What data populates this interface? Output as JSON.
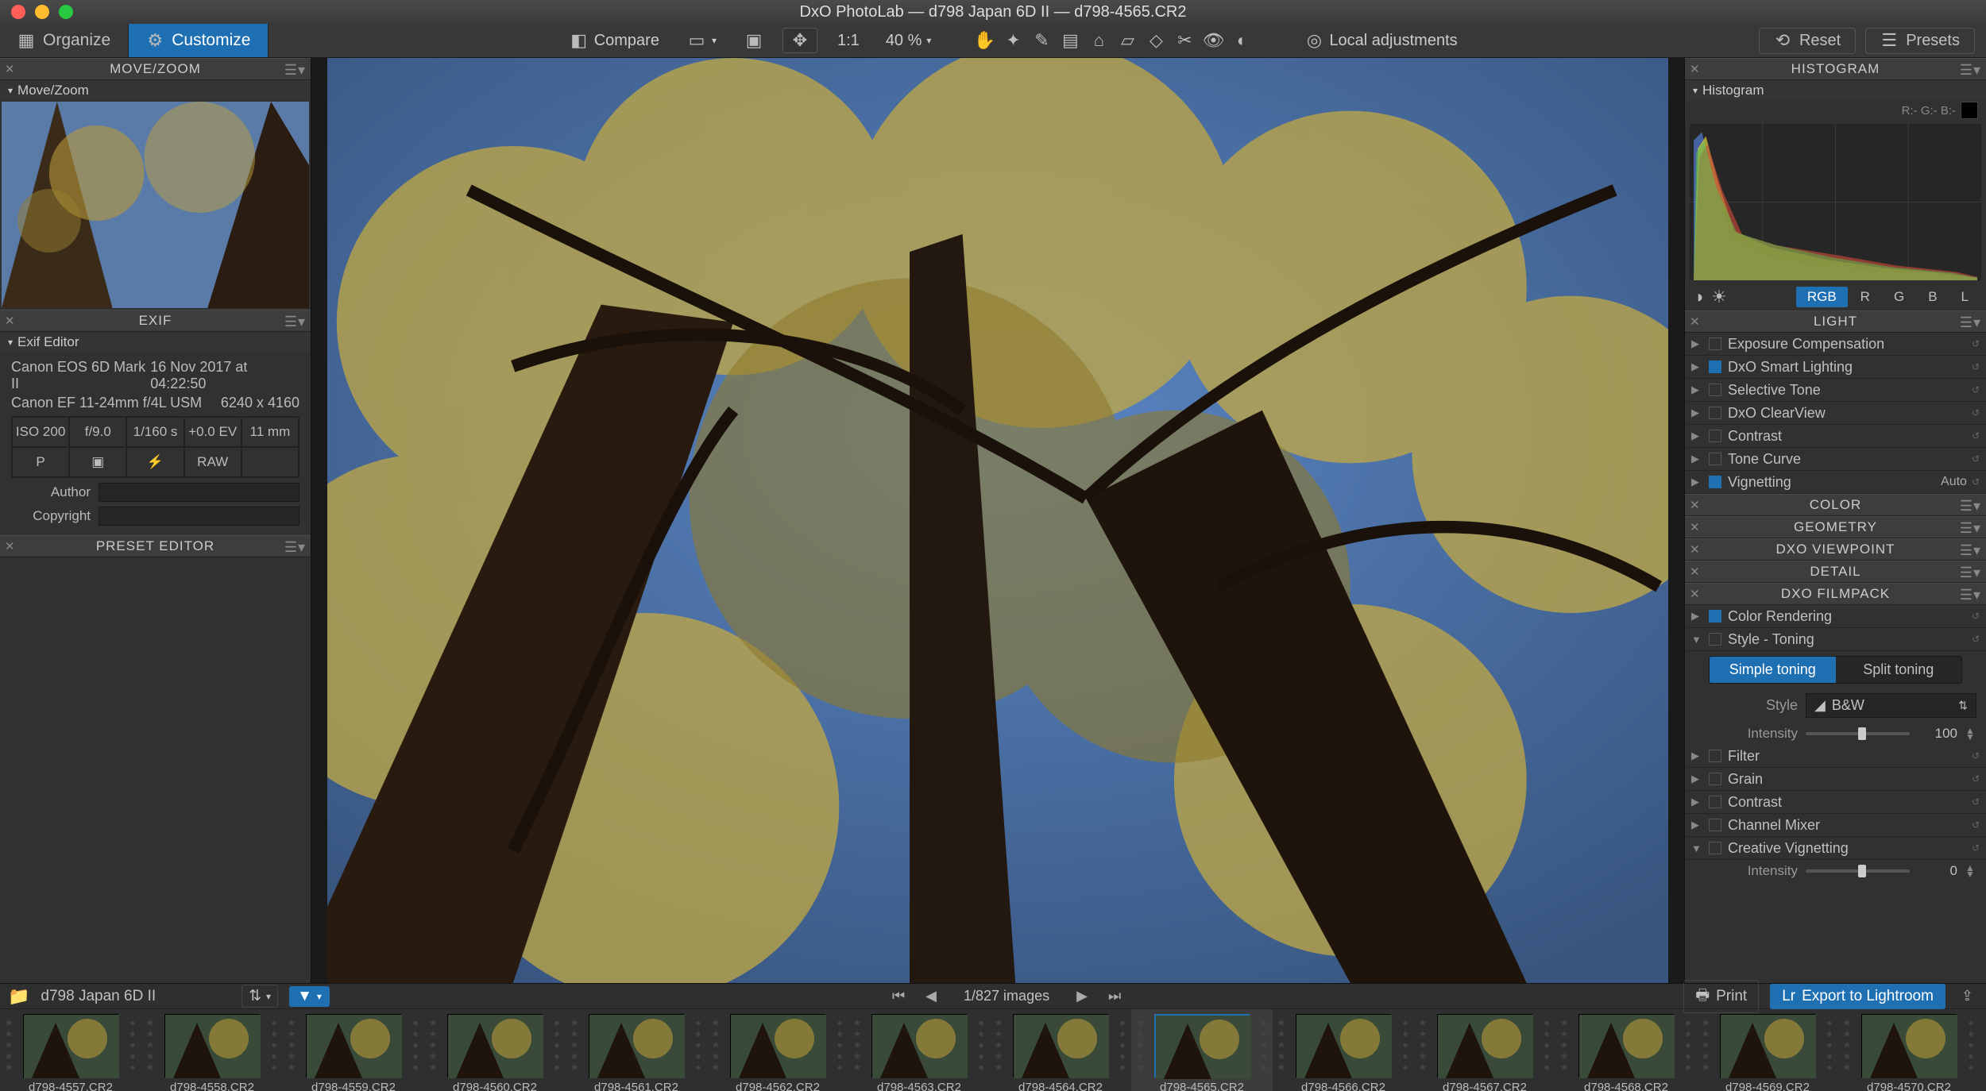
{
  "window_title": "DxO PhotoLab — d798 Japan 6D II — d798-4565.CR2",
  "mode_tabs": {
    "organize": "Organize",
    "customize": "Customize"
  },
  "toolbar": {
    "compare": "Compare",
    "one_to_one": "1:1",
    "zoom_pct": "40 %",
    "local_adjustments": "Local adjustments",
    "reset": "Reset",
    "presets": "Presets"
  },
  "left": {
    "movezoom_title": "MOVE/ZOOM",
    "movezoom_sub": "Move/Zoom",
    "exif_title": "EXIF",
    "exif_sub": "Exif Editor",
    "camera": "Canon EOS 6D Mark II",
    "datetime": "16 Nov 2017 at 04:22:50",
    "lens": "Canon EF 11-24mm f/4L USM",
    "dimensions": "6240 x 4160",
    "iso": "ISO 200",
    "aperture": "f/9.0",
    "shutter": "1/160 s",
    "ev": "+0.0 EV",
    "focal": "11 mm",
    "mode": "P",
    "format": "RAW",
    "author_label": "Author",
    "copyright_label": "Copyright",
    "preset_editor_title": "PRESET EDITOR"
  },
  "right": {
    "histogram_title": "HISTOGRAM",
    "histogram_sub": "Histogram",
    "rgb_readout": "R:- G:- B:-",
    "channels": {
      "rgb": "RGB",
      "r": "R",
      "g": "G",
      "b": "B",
      "l": "L"
    },
    "sections": {
      "light": "LIGHT",
      "color": "COLOR",
      "geometry": "GEOMETRY",
      "viewpoint": "DXO VIEWPOINT",
      "detail": "DETAIL",
      "filmpack": "DXO FILMPACK"
    },
    "light_items": {
      "exposure": "Exposure Compensation",
      "smart": "DxO Smart Lighting",
      "selective": "Selective Tone",
      "clearview": "DxO ClearView",
      "contrast": "Contrast",
      "tone_curve": "Tone Curve",
      "vignetting": "Vignetting",
      "vignetting_val": "Auto"
    },
    "filmpack": {
      "color_rendering": "Color Rendering",
      "style_toning": "Style - Toning",
      "simple_toning": "Simple toning",
      "split_toning": "Split toning",
      "style_label": "Style",
      "style_value": "B&W",
      "intensity_label": "Intensity",
      "intensity_value": "100",
      "filter": "Filter",
      "grain": "Grain",
      "contrast": "Contrast",
      "channel_mixer": "Channel Mixer",
      "creative_vignetting": "Creative Vignetting",
      "cv_intensity_label": "Intensity",
      "cv_intensity_value": "0"
    }
  },
  "bottom": {
    "folder_name": "d798 Japan 6D II",
    "page_label": "1/827 images",
    "print": "Print",
    "export_lr": "Export to Lightroom",
    "thumbs": [
      "d798-4557.CR2",
      "d798-4558.CR2",
      "d798-4559.CR2",
      "d798-4560.CR2",
      "d798-4561.CR2",
      "d798-4562.CR2",
      "d798-4563.CR2",
      "d798-4564.CR2",
      "d798-4565.CR2",
      "d798-4566.CR2",
      "d798-4567.CR2",
      "d798-4568.CR2",
      "d798-4569.CR2",
      "d798-4570.CR2"
    ],
    "selected_index": 8
  }
}
